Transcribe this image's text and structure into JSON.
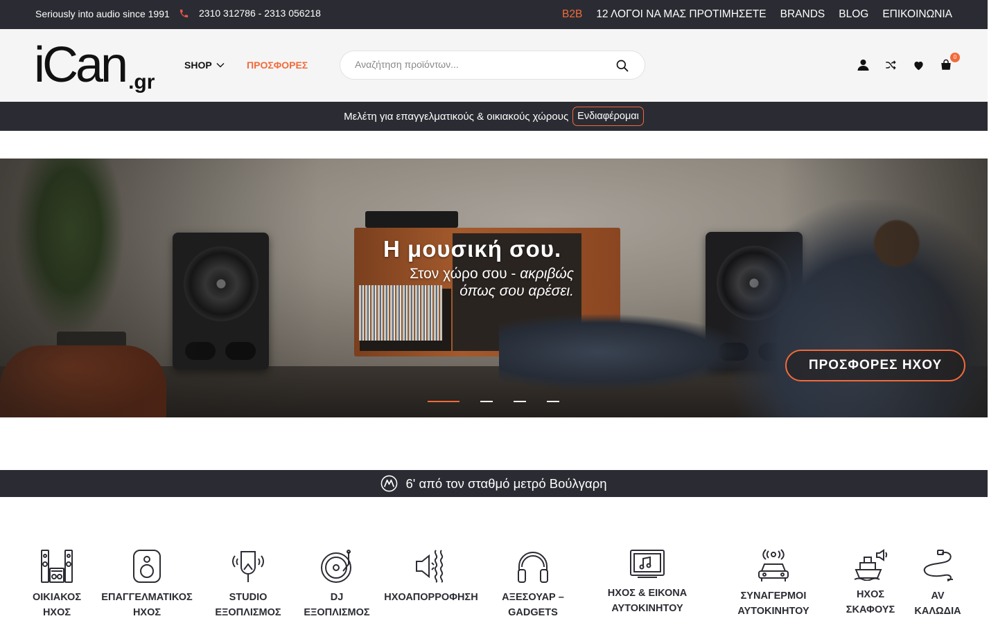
{
  "topbar": {
    "tagline": "Seriously into audio since 1991",
    "phone": "2310 312786 - 2313 056218",
    "nav": [
      {
        "label": "B2B",
        "accent": true
      },
      {
        "label": "12 ΛΟΓΟΙ ΝΑ ΜΑΣ ΠΡΟΤΙΜΗΣΕΤΕ",
        "accent": false
      },
      {
        "label": "BRANDS",
        "accent": false
      },
      {
        "label": "BLOG",
        "accent": false
      },
      {
        "label": "ΕΠΙΚΟΙΝΩΝΙΑ",
        "accent": false
      }
    ]
  },
  "header": {
    "logo_main": "iCan",
    "logo_suffix": ".gr",
    "shop_label": "SHOP",
    "offers_label": "ΠΡΟΣΦΟΡΕΣ",
    "search_placeholder": "Αναζήτηση προϊόντων...",
    "cart_count": "0",
    "icons": [
      "user-icon",
      "compare-icon",
      "heart-icon",
      "cart-icon"
    ]
  },
  "promo": {
    "text": "Μελέτη για επαγγελματικούς & οικιακούς χώρους",
    "button": "Ενδιαφέρομαι"
  },
  "hero": {
    "title": "Η μουσική σου.",
    "subtitle_plain": "Στον χώρο σου - ",
    "subtitle_italic_1": "ακριβώς",
    "subtitle_italic_2": "όπως σου αρέσει.",
    "cta": "ΠΡΟΣΦΟΡΕΣ ΗΧΟΥ",
    "slides": 4,
    "active_slide": 1
  },
  "metro": {
    "text": "6' από τον σταθμό μετρό Βούλγαρη",
    "icon": "metro-icon"
  },
  "categories": [
    {
      "line1": "ΟΙΚΙΑΚΟΣ",
      "line2": "ΗΧΟΣ",
      "icon": "home-audio-icon"
    },
    {
      "line1": "ΕΠΑΓΓΕΛΜΑΤΙΚΟΣ",
      "line2": "ΗΧΟΣ",
      "icon": "speaker-icon"
    },
    {
      "line1": "STUDIO",
      "line2": "ΕΞΟΠΛΙΣΜΟΣ",
      "icon": "microphone-icon"
    },
    {
      "line1": "DJ",
      "line2": "ΕΞΟΠΛΙΣΜΟΣ",
      "icon": "turntable-icon"
    },
    {
      "line1": "ΗΧΟΑΠΟΡΡΟΦΗΣΗ",
      "line2": "",
      "icon": "acoustic-panel-icon"
    },
    {
      "line1": "ΑΞΕΣΟΥΑΡ –",
      "line2": "GADGETS",
      "icon": "headphones-icon"
    },
    {
      "line1": "ΗΧΟΣ & ΕΙΚΟΝΑ",
      "line2": "ΑΥΤΟΚΙΝΗΤΟΥ",
      "icon": "car-multimedia-icon"
    },
    {
      "line1": "ΣΥΝΑΓΕΡΜΟΙ",
      "line2": "ΑΥΤΟΚΙΝΗΤΟΥ",
      "icon": "car-alarm-icon"
    },
    {
      "line1": "ΗΧΟΣ",
      "line2": "ΣΚΑΦΟΥΣ",
      "icon": "boat-audio-icon"
    },
    {
      "line1": "AV",
      "line2": "ΚΑΛΩΔΙΑ",
      "icon": "cable-icon"
    }
  ],
  "colors": {
    "accent": "#f26a3a",
    "dark_bar": "#2b2c33",
    "header_bg": "#f5f5f5"
  }
}
